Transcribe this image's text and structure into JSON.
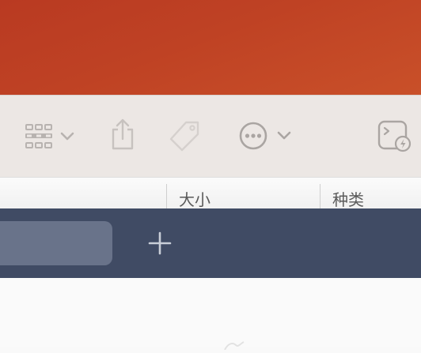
{
  "toolbar": {
    "buttons": [
      {
        "name": "view-grid-button",
        "icon": "grid-icon",
        "has_menu": true
      },
      {
        "name": "share-button",
        "icon": "share-icon"
      },
      {
        "name": "tags-button",
        "icon": "tag-icon"
      },
      {
        "name": "more-actions-button",
        "icon": "ellipsis-circle-icon",
        "has_menu": true
      },
      {
        "name": "quick-action-button",
        "icon": "terminal-bolt-icon"
      }
    ]
  },
  "columns": {
    "size_label": "大小",
    "kind_label": "种类"
  },
  "tabbar": {
    "new_tab_icon": "plus-icon"
  },
  "colors": {
    "desktop": "#bf4224",
    "toolbar_bg": "#ece7e4",
    "tabbar_bg": "#404b64",
    "tab_bg": "#69738a"
  }
}
